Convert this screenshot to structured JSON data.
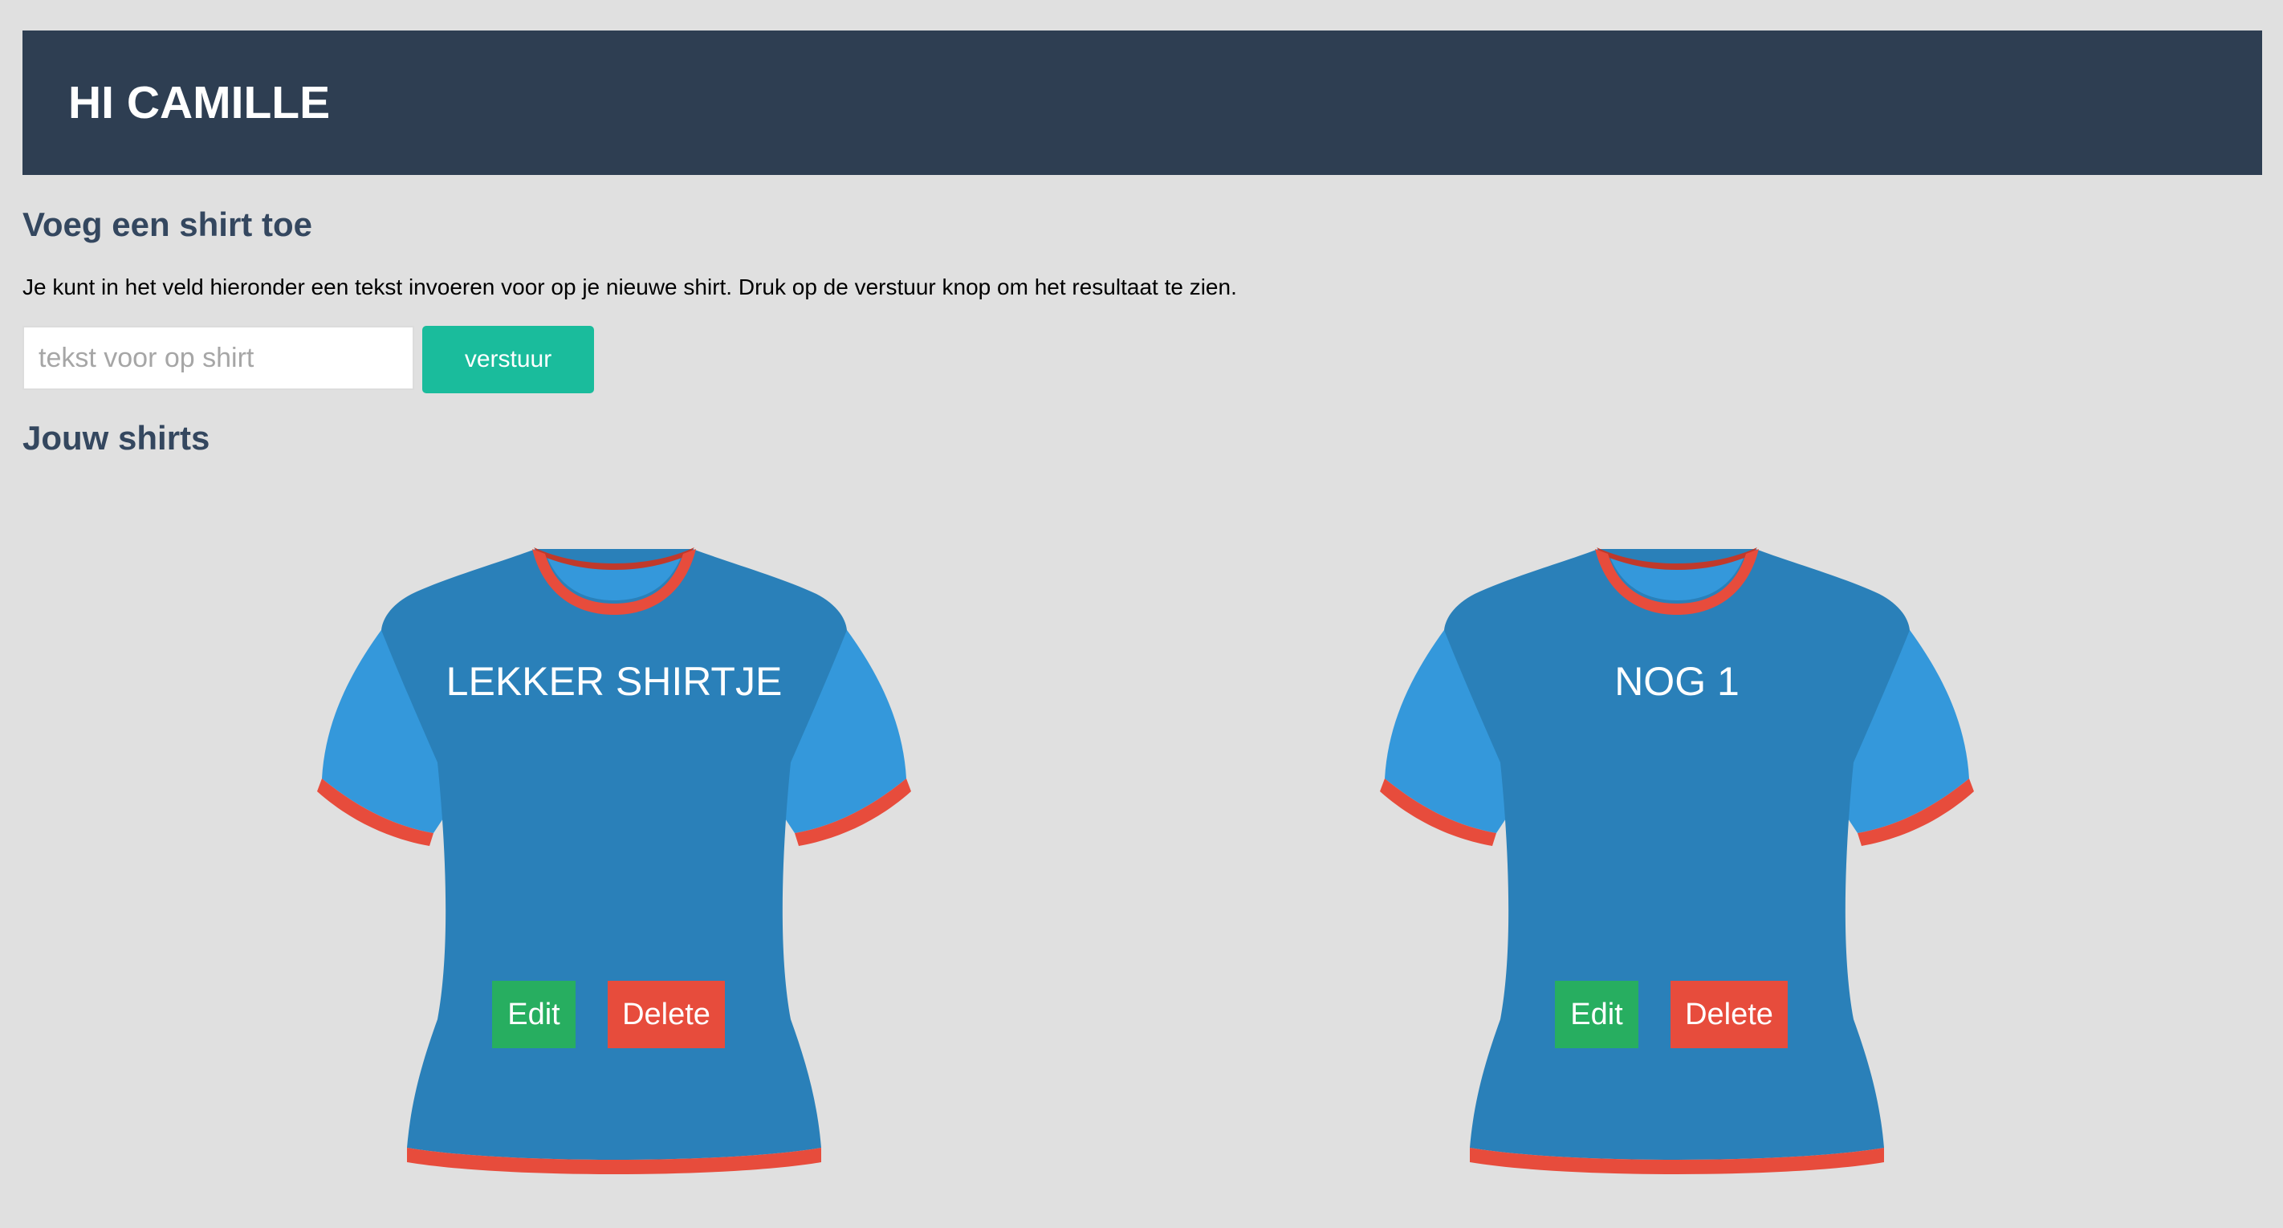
{
  "header": {
    "greeting": "HI CAMILLE"
  },
  "add_section": {
    "title": "Voeg een shirt toe",
    "description": "Je kunt in het veld hieronder een tekst invoeren voor op je nieuwe shirt. Druk op de verstuur knop om het resultaat te zien.",
    "input_placeholder": "tekst voor op shirt",
    "input_value": "",
    "submit_label": "verstuur"
  },
  "shirts_section": {
    "title": "Jouw shirts",
    "shirts": [
      {
        "text": "LEKKER SHIRTJE",
        "edit_label": "Edit",
        "delete_label": "Delete"
      },
      {
        "text": "NOG 1",
        "edit_label": "Edit",
        "delete_label": "Delete"
      }
    ]
  },
  "colors": {
    "header_bg": "#2e3e52",
    "heading_text": "#34475f",
    "page_bg": "#e0e0e0",
    "submit_button": "#1abc9c",
    "shirt_body": "#2a80b9",
    "shirt_sleeve": "#3498db",
    "shirt_trim": "#e74c3c",
    "edit_button": "#27ae60",
    "delete_button": "#e74c3c"
  }
}
